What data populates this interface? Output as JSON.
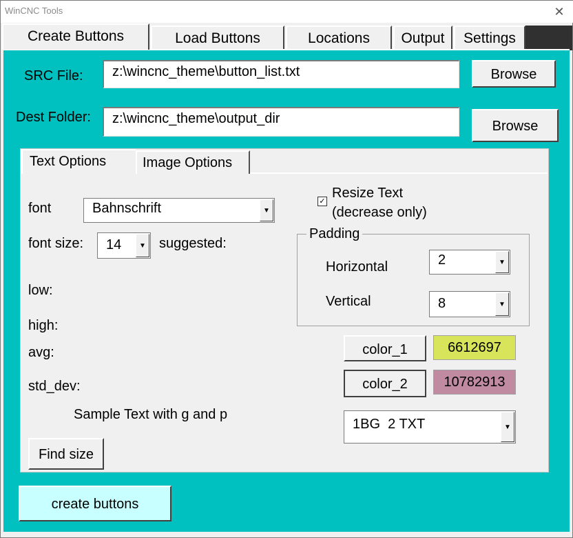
{
  "window": {
    "title": "WinCNC Tools",
    "close_glyph": "✕"
  },
  "tabs": [
    {
      "label": "Create Buttons"
    },
    {
      "label": "Load Buttons"
    },
    {
      "label": "Locations"
    },
    {
      "label": "Output"
    },
    {
      "label": "Settings"
    }
  ],
  "src": {
    "label": "SRC File:",
    "value": "z:\\wincnc_theme\\button_list.txt",
    "browse_label": "Browse"
  },
  "dest": {
    "label": "Dest Folder:",
    "value": "z:\\wincnc_theme\\output_dir",
    "browse_label": "Browse"
  },
  "inner_tabs": [
    {
      "label": "Text Options"
    },
    {
      "label": "Image Options"
    }
  ],
  "text_options": {
    "font_label": "font",
    "font_value": "Bahnschrift",
    "font_size_label": "font size:",
    "font_size_value": "14",
    "suggested_label": "suggested:",
    "low_label": "low:",
    "high_label": "high:",
    "avg_label": "avg:",
    "std_dev_label": "std_dev:",
    "sample_text": "Sample Text with g and p",
    "find_size_label": "Find size",
    "resize_line1": "Resize Text",
    "resize_line2": "(decrease only)",
    "resize_checked": true,
    "check_glyph": "✓",
    "padding_label": "Padding",
    "horizontal_label": "Horizontal",
    "horizontal_value": "2",
    "vertical_label": "Vertical",
    "vertical_value": "8",
    "color1_label": "color_1",
    "color1_value": "6612697",
    "color1_hex": "#d8e45a",
    "color2_label": "color_2",
    "color2_value": "10782913",
    "color2_hex": "#c08aa0",
    "mode_value": "1BG  2 TXT",
    "arrow_glyph": "▼"
  },
  "create_buttons_label": "create buttons",
  "colors": {
    "teal": "#00c0c0",
    "create_button_bg": "#c8ffff"
  }
}
